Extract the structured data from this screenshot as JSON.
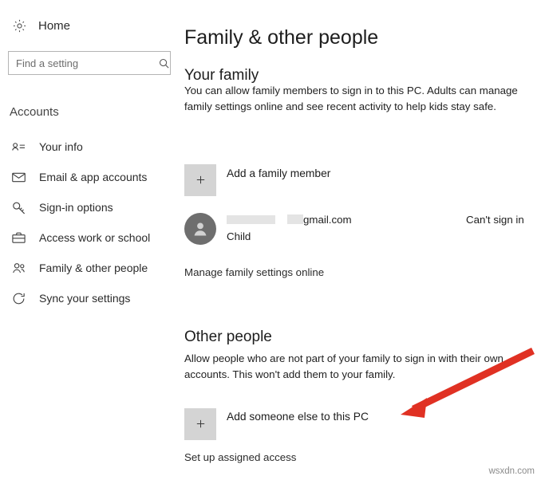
{
  "sidebar": {
    "home_label": "Home",
    "home_icon": "gear-icon",
    "search": {
      "placeholder": "Find a setting",
      "value": "",
      "icon": "search-icon"
    },
    "section_title": "Accounts",
    "items": [
      {
        "label": "Your info",
        "icon": "person-badge-icon"
      },
      {
        "label": "Email & app accounts",
        "icon": "envelope-icon"
      },
      {
        "label": "Sign-in options",
        "icon": "key-icon"
      },
      {
        "label": "Access work or school",
        "icon": "briefcase-icon"
      },
      {
        "label": "Family & other people",
        "icon": "people-icon"
      },
      {
        "label": "Sync your settings",
        "icon": "sync-icon"
      }
    ]
  },
  "main": {
    "page_title": "Family & other people",
    "family": {
      "heading": "Your family",
      "description": "You can allow family members to sign in to this PC. Adults can manage family settings online and see recent activity to help kids stay safe.",
      "add_member_label": "Add a family member",
      "add_member_icon": "plus-icon",
      "account": {
        "name": "",
        "email": "gmail.com",
        "role": "Child",
        "status": "Can't sign in",
        "avatar_icon": "person-icon"
      },
      "manage_link": "Manage family settings online"
    },
    "other_people": {
      "heading": "Other people",
      "description": "Allow people who are not part of your family to sign in with their own accounts. This won't add them to your family.",
      "add_someone_label": "Add someone else to this PC",
      "add_someone_icon": "plus-icon",
      "assigned_access_link": "Set up assigned access"
    }
  },
  "annotation": {
    "arrow_color": "#e03123",
    "arrow_name": "red-arrow-pointing-to-add-someone"
  },
  "watermark": "wsxdn.com"
}
